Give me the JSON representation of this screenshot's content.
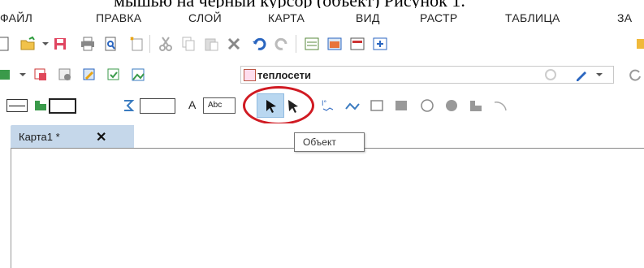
{
  "caption": "мышью на черный курсор (объект) Рисунок 1.",
  "menu": [
    {
      "label": "ФАЙЛ"
    },
    {
      "label": "ПРАВКА"
    },
    {
      "label": "СЛОЙ"
    },
    {
      "label": "КАРТА"
    },
    {
      "label": "ВИД"
    },
    {
      "label": "РАСТР"
    },
    {
      "label": "ТАБЛИЦА"
    },
    {
      "label": "ЗА"
    }
  ],
  "toolbar2": {
    "layer_value": "теплосети"
  },
  "toolbar3": {
    "abc_label": "A",
    "abc_sample": "Abc"
  },
  "tab": {
    "label": "Карта1 *",
    "close_glyph": "✕"
  },
  "tooltip": {
    "text": "Объект"
  },
  "colors": {
    "tab_active": "#c5d7ea",
    "selected_tool": "#b9d7f0",
    "highlight": "#d01a22"
  }
}
